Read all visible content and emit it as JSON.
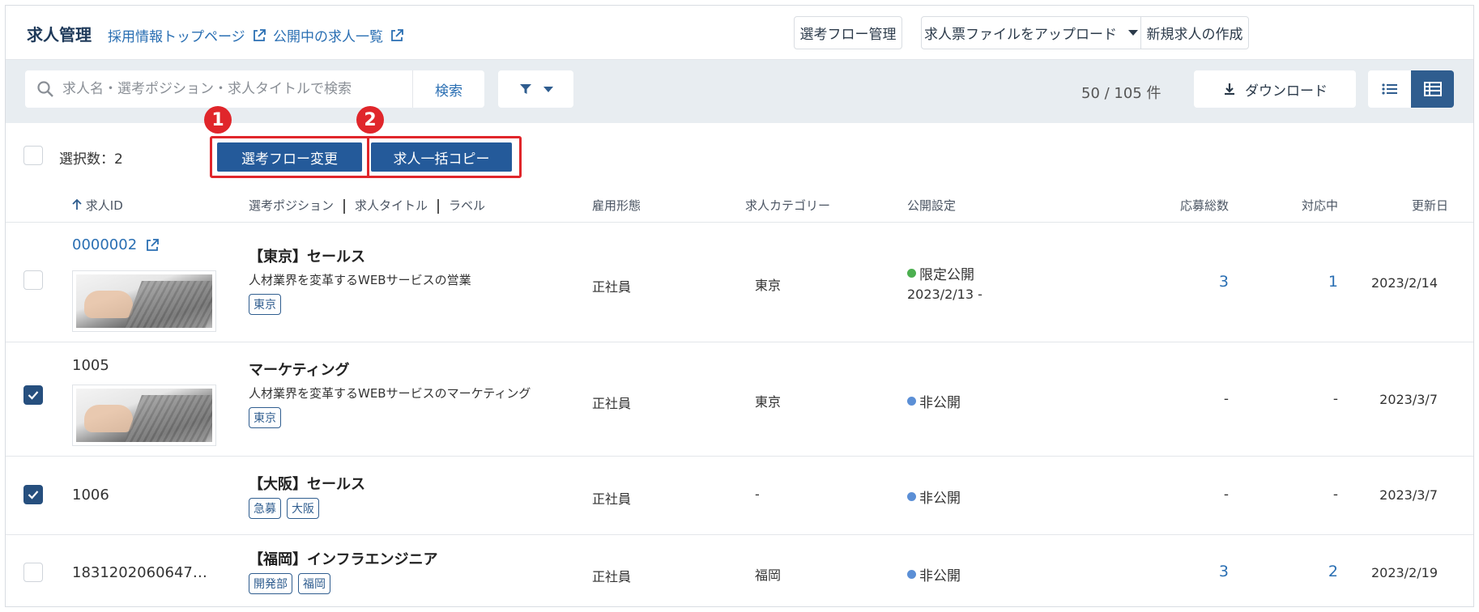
{
  "header": {
    "title": "求人管理",
    "links": [
      {
        "label": "採用情報トップページ"
      },
      {
        "label": "公開中の求人一覧"
      }
    ],
    "flow_button": "選考フロー管理",
    "upload_button": "求人票ファイルをアップロード",
    "new_button": "新規求人の作成"
  },
  "toolbar": {
    "search_placeholder": "求人名・選考ポジション・求人タイトルで検索",
    "search_button": "検索",
    "count": "50 / 105 件",
    "download_label": "ダウンロード"
  },
  "selection": {
    "label": "選択数：2",
    "actions": [
      "選考フロー変更",
      "求人一括コピー"
    ],
    "markers": [
      "1",
      "2"
    ]
  },
  "table": {
    "columns": {
      "id": "求人ID",
      "position": "選考ポジション",
      "job_title": "求人タイトル",
      "label": "ラベル",
      "employment": "雇用形態",
      "category": "求人カテゴリー",
      "visibility": "公開設定",
      "applications": "応募総数",
      "in_progress": "対応中",
      "updated": "更新日"
    },
    "rows": [
      {
        "id": "0000002",
        "checked": false,
        "title": "【東京】セールス",
        "description": "人材業界を変革するWEBサービスの営業",
        "tags": [
          "東京"
        ],
        "employment": "正社員",
        "category": "東京",
        "status": "限定公開",
        "status_color": "#4caf50",
        "status_date": "2023/2/13 -",
        "applications": "3",
        "in_progress": "1",
        "updated": "2023/2/14"
      },
      {
        "id": "1005",
        "checked": true,
        "title": "マーケティング",
        "description": "人材業界を変革するWEBサービスのマーケティング",
        "tags": [
          "東京"
        ],
        "employment": "正社員",
        "category": "東京",
        "status": "非公開",
        "status_color": "#5b8fd6",
        "applications": "-",
        "in_progress": "-",
        "updated": "2023/3/7"
      },
      {
        "id": "1006",
        "checked": true,
        "title": "【大阪】セールス",
        "tags": [
          "急募",
          "大阪"
        ],
        "employment": "正社員",
        "category": "-",
        "status": "非公開",
        "status_color": "#5b8fd6",
        "applications": "-",
        "in_progress": "-",
        "updated": "2023/3/7"
      },
      {
        "id": "1831202060647…",
        "checked": false,
        "title": "【福岡】インフラエンジニア",
        "tags": [
          "開発部",
          "福岡"
        ],
        "employment": "正社員",
        "category": "福岡",
        "status": "非公開",
        "status_color": "#5b8fd6",
        "applications": "3",
        "in_progress": "2",
        "updated": "2023/2/19"
      }
    ]
  }
}
